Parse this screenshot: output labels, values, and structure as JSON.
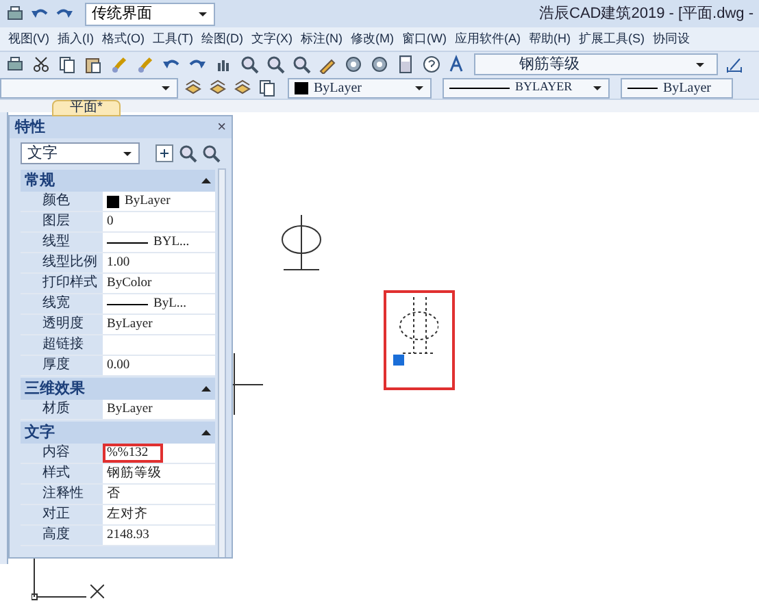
{
  "title_bar": {
    "workspace": "传统界面",
    "title": "浩辰CAD建筑2019 - [平面.dwg -"
  },
  "menu_bar": [
    "视图(V)",
    "插入(I)",
    "格式(O)",
    "工具(T)",
    "绘图(D)",
    "文字(X)",
    "标注(N)",
    "修改(M)",
    "窗口(W)",
    "应用软件(A)",
    "帮助(H)",
    "扩展工具(S)",
    "协同设"
  ],
  "toolbar": {
    "text_style": "钢筋等级"
  },
  "properties_toolbar": {
    "color_setting": "ByLayer",
    "linetype": "BYLAYER",
    "lineweight": "ByLayer"
  },
  "document_tab": {
    "label": "平面*"
  },
  "properties_panel": {
    "title": "特性",
    "close": "×",
    "selection": "文字",
    "sections": [
      {
        "title": "常规",
        "expanded": true,
        "rows": [
          {
            "label": "颜色",
            "value": "ByLayer",
            "kind": "swatch"
          },
          {
            "label": "图层",
            "value": "0",
            "kind": "text"
          },
          {
            "label": "线型",
            "value": "BYL...",
            "kind": "line"
          },
          {
            "label": "线型比例",
            "value": "1.00",
            "kind": "text"
          },
          {
            "label": "打印样式",
            "value": "ByColor",
            "kind": "text"
          },
          {
            "label": "线宽",
            "value": "ByL...",
            "kind": "line"
          },
          {
            "label": "透明度",
            "value": "ByLayer",
            "kind": "text"
          },
          {
            "label": "超链接",
            "kind": "text"
          },
          {
            "label": "厚度",
            "value": "0.00",
            "kind": "text"
          }
        ]
      },
      {
        "title": "三维效果",
        "expanded": true,
        "rows": [
          {
            "label": "材质",
            "value": "ByLayer",
            "kind": "text"
          }
        ]
      },
      {
        "title": "文字",
        "expanded": true,
        "rows": [
          {
            "label": "内容",
            "value": "%%132",
            "kind": "text",
            "highlighted": true
          },
          {
            "label": "样式",
            "value": "钢筋等级",
            "kind": "text"
          },
          {
            "label": "注释性",
            "value": "否",
            "kind": "text"
          },
          {
            "label": "对正",
            "value": "左对齐",
            "kind": "text"
          },
          {
            "label": "高度",
            "value": "2148.93",
            "kind": "text"
          }
        ]
      }
    ]
  }
}
